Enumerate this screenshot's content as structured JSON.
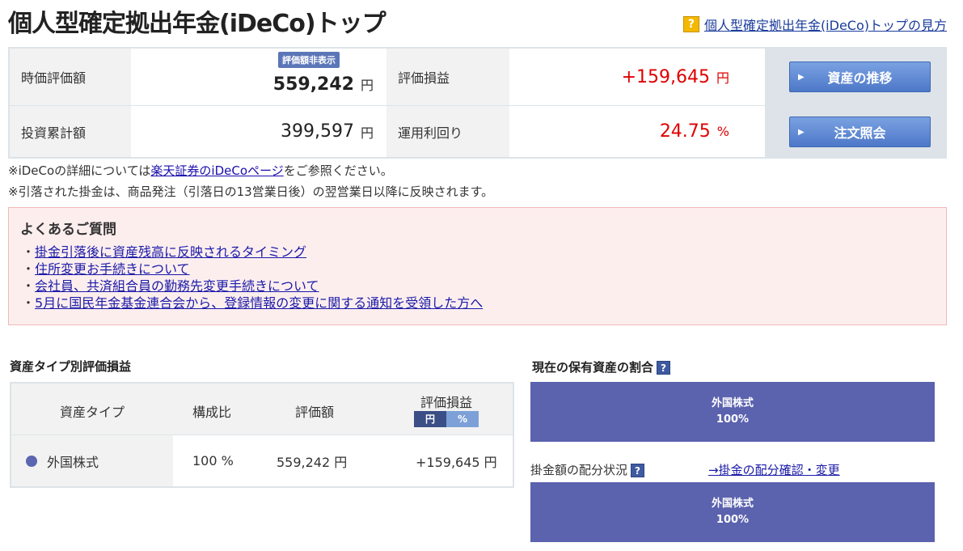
{
  "page": {
    "title": "個人型確定拠出年金(iDeCo)トップ",
    "help_link": "個人型確定拠出年金(iDeCo)トップの見方",
    "help_icon": "?"
  },
  "summary": {
    "market_value_label": "時価評価額",
    "market_value": "559,242",
    "market_value_unit": "円",
    "badge": "評価額非表示",
    "gain_label": "評価損益",
    "gain": "+159,645",
    "gain_unit": "円",
    "invested_label": "投資累計額",
    "invested": "399,597",
    "invested_unit": "円",
    "yield_label": "運用利回り",
    "yield": "24.75",
    "yield_unit": "%",
    "btn_asset_history": "資産の推移",
    "btn_order_inquiry": "注文照会",
    "btn_arrow": "▶"
  },
  "notes": {
    "line1_pre": "※iDeCoの詳細については",
    "line1_link": "楽天証券のiDeCoページ",
    "line1_post": "をご参照ください。",
    "line2": "※引落された掛金は、商品発注（引落日の13営業日後）の翌営業日以降に反映されます。"
  },
  "faq": {
    "title": "よくあるご質問",
    "bullet": "・",
    "items": [
      "掛金引落後に資産残高に反映されるタイミング",
      "住所変更お手続きについて",
      "会社員、共済組合員の勤務先変更手続きについて",
      "5月に国民年金基金連合会から、登録情報の変更に関する通知を受領した方へ"
    ]
  },
  "asset_section": {
    "title": "資産タイプ別評価損益",
    "headers": [
      "資産タイプ",
      "構成比",
      "評価額",
      "評価損益"
    ],
    "toggle_yen": "円",
    "toggle_pct": "%",
    "rows": [
      {
        "type": "外国株式",
        "ratio": "100 %",
        "value": "559,242 円",
        "gain": "+159,645 円"
      }
    ]
  },
  "holdings": {
    "title": "現在の保有資産の割合",
    "help_icon": "?",
    "bar_label": "外国株式",
    "bar_pct": "100%"
  },
  "allocation": {
    "title": "掛金額の配分状況",
    "help_icon": "?",
    "link": "→掛金の配分確認・変更",
    "bar_label": "外国株式",
    "bar_pct": "100%"
  },
  "colors": {
    "accent_blue": "#5b62ae",
    "gain_red": "#e00000",
    "faq_bg": "#fdeeee"
  }
}
